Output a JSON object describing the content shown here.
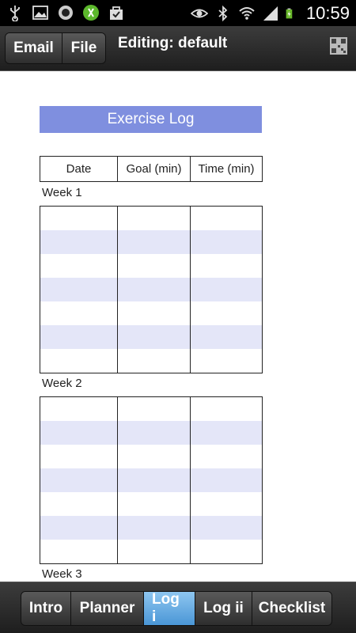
{
  "status_bar": {
    "time": "10:59",
    "left_icons": [
      "usb-icon",
      "image-icon",
      "voicemail-icon",
      "running-app-icon",
      "shopping-bag-icon"
    ],
    "right_icons": [
      "eye-icon",
      "bluetooth-icon",
      "wifi-icon",
      "signal-icon",
      "battery-charging-icon"
    ]
  },
  "action_bar": {
    "email_label": "Email",
    "file_label": "File",
    "title": "Editing: default",
    "qr_icon": "qr-code-icon"
  },
  "document": {
    "title": "Exercise Log",
    "headers": [
      "Date",
      "Goal (min)",
      "Time (min)"
    ],
    "weeks": [
      "Week 1",
      "Week 2",
      "Week 3"
    ],
    "shade_color": "#e4e6f8",
    "title_color": "#7f8fdf"
  },
  "tabs": [
    {
      "label": "Intro",
      "active": false
    },
    {
      "label": "Planner",
      "active": false
    },
    {
      "label": "Log i",
      "active": true
    },
    {
      "label": "Log ii",
      "active": false
    },
    {
      "label": "Checklist",
      "active": false
    }
  ]
}
